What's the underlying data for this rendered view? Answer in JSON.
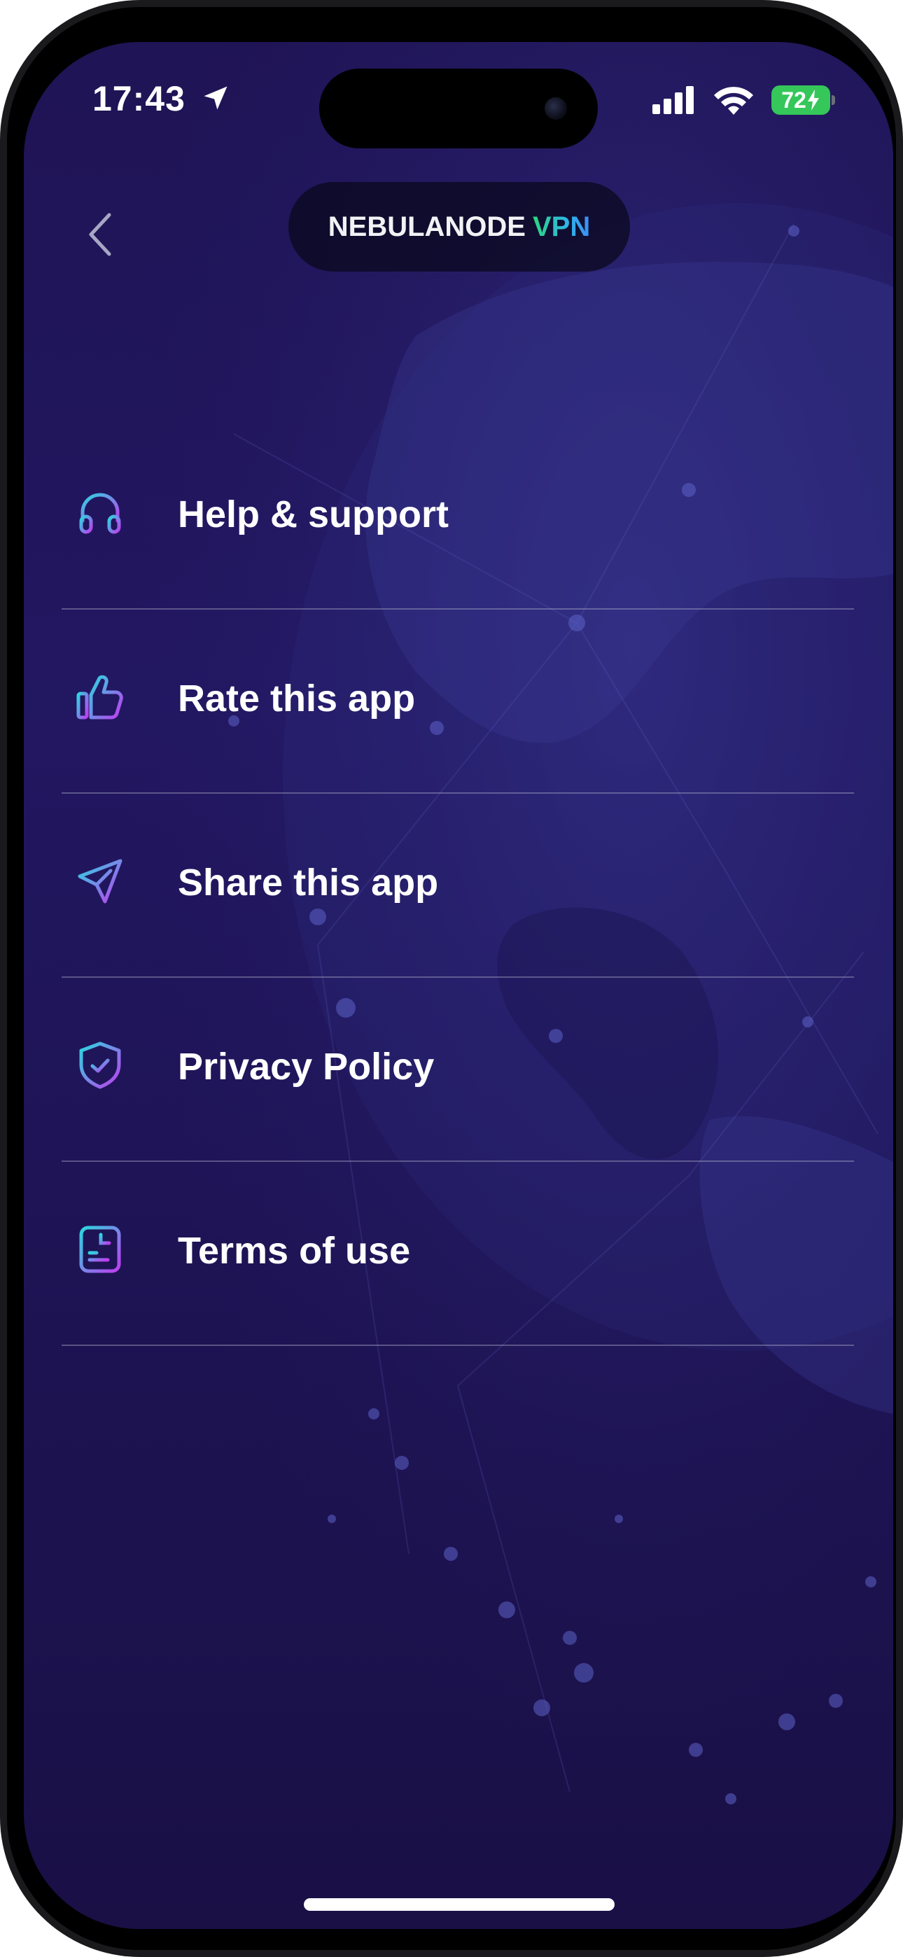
{
  "status_bar": {
    "time": "17:43",
    "battery_level": "72",
    "icons": [
      "location-arrow-icon",
      "cellular-signal-icon",
      "wifi-icon",
      "battery-charging-icon"
    ]
  },
  "header": {
    "back_icon": "chevron-left-icon",
    "brand_name": "NEBULANODE",
    "brand_suffix": "VPN"
  },
  "menu": {
    "items": [
      {
        "label": "Help & support",
        "icon": "headphones-icon"
      },
      {
        "label": "Rate this app",
        "icon": "thumbs-up-icon"
      },
      {
        "label": "Share this app",
        "icon": "paper-plane-icon"
      },
      {
        "label": "Privacy Policy",
        "icon": "shield-check-icon"
      },
      {
        "label": "Terms of use",
        "icon": "document-icon"
      }
    ]
  },
  "colors": {
    "background": "#221761",
    "accent_cyan": "#2bd7e0",
    "accent_magenta": "#c03cf0",
    "brand_green": "#2bd77e",
    "brand_blue": "#3a8df5",
    "battery_green": "#35c759"
  }
}
